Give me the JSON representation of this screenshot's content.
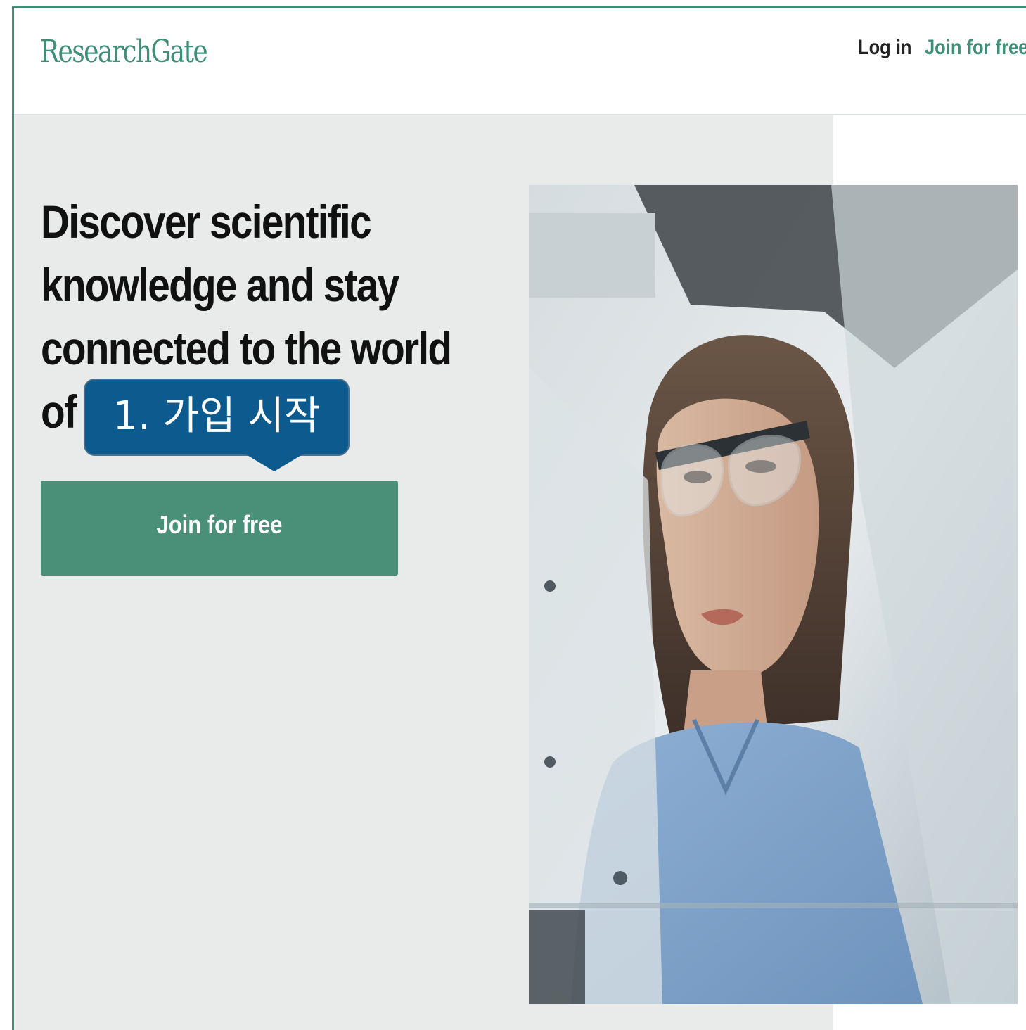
{
  "header": {
    "logo_text": "ResearchGate",
    "login_label": "Log in",
    "join_label": "Join for free"
  },
  "hero": {
    "headline_line1": "Discover scientific",
    "headline_line2": "knowledge and stay",
    "headline_line3": "connected to the world",
    "headline_line4": "of",
    "cta_label": "Join for free"
  },
  "annotation": {
    "callout_text": "1. 가입 시작"
  },
  "photo": {
    "description_icon": "scientist-photo"
  },
  "colors": {
    "brand_green": "#3f8f78",
    "cta_green": "#4a9078",
    "callout_blue": "#0d5a8f",
    "hero_bg": "#e9ebea"
  }
}
